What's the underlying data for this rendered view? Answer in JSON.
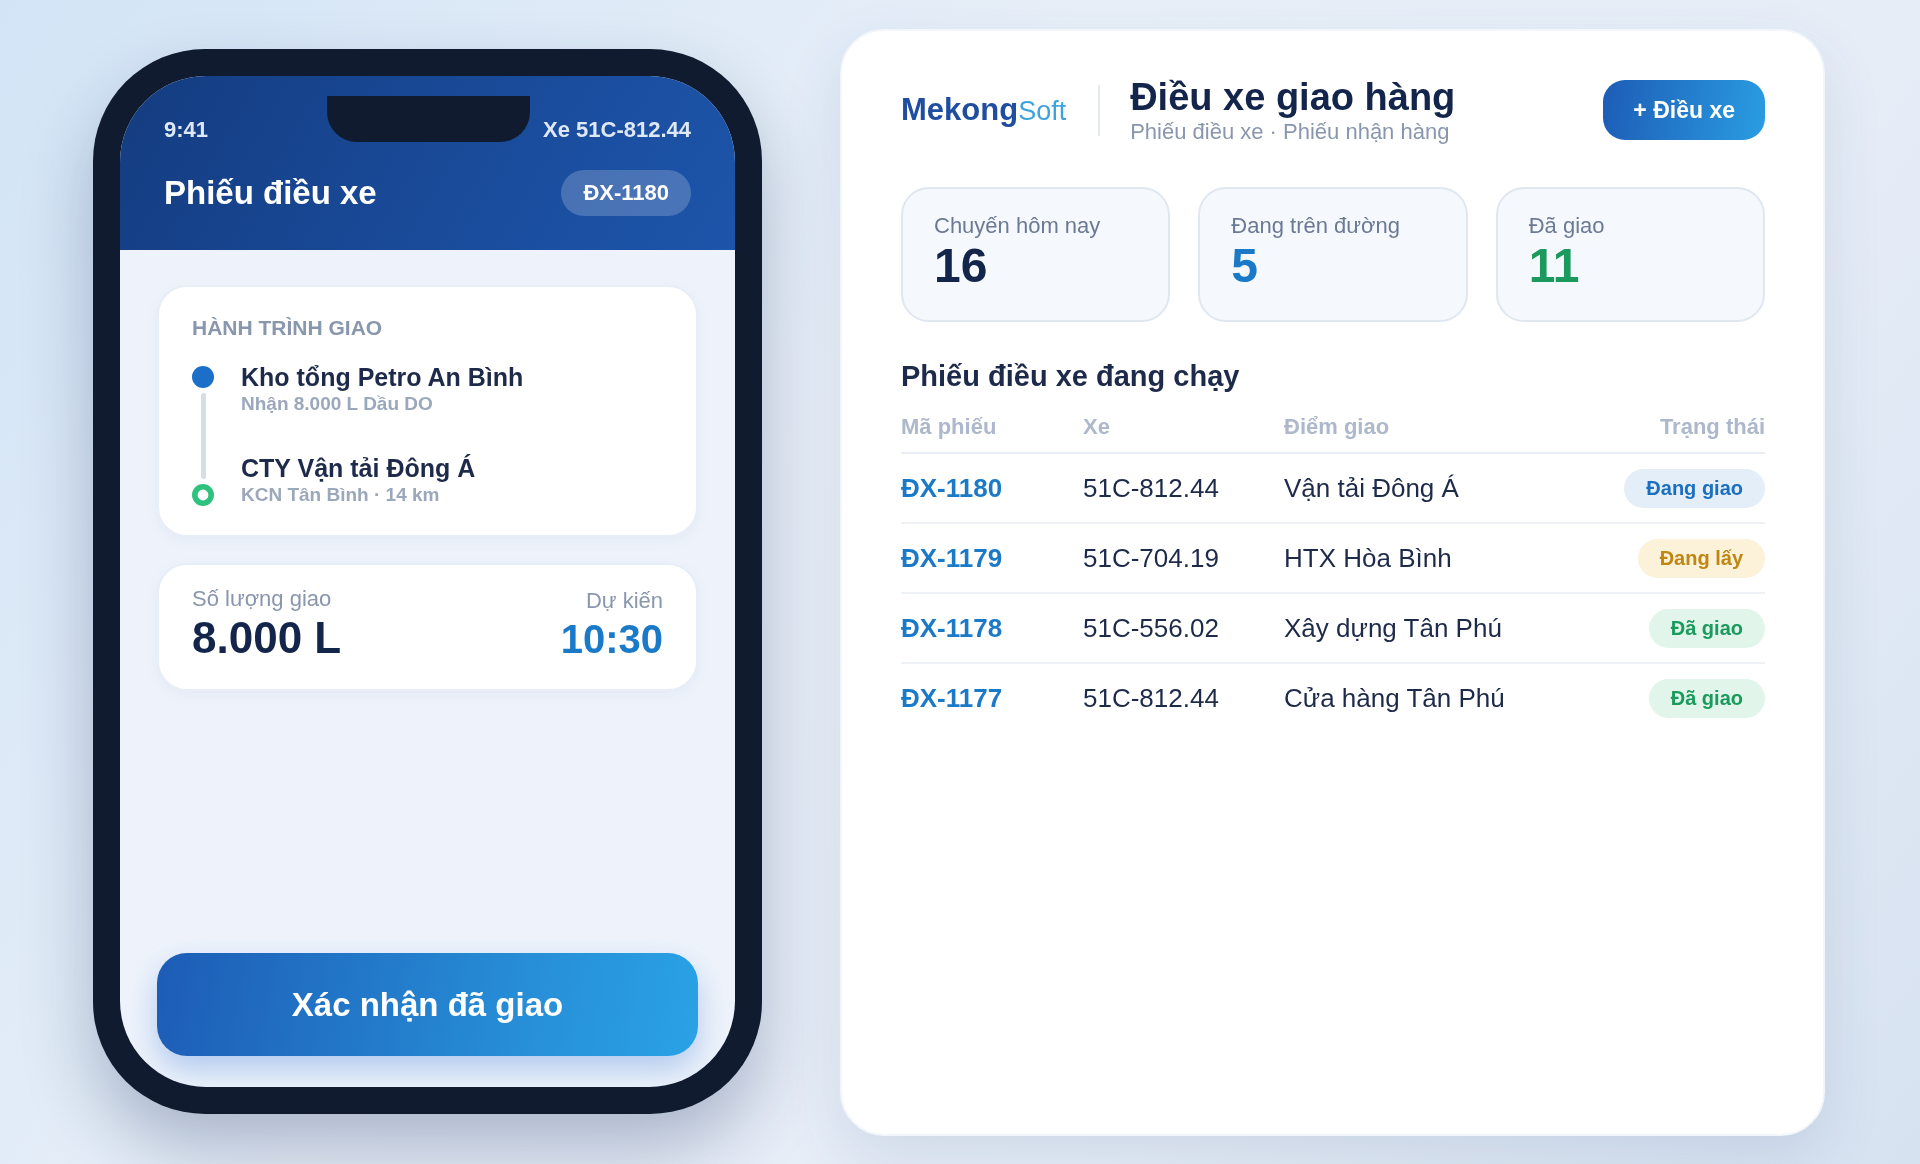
{
  "phone": {
    "status_bar": {
      "time": "9:41",
      "vehicle": "Xe 51C-812.44"
    },
    "header": {
      "title": "Phiếu điều xe",
      "badge": "ĐX-1180"
    },
    "route_card": {
      "heading": "HÀNH TRÌNH GIAO",
      "stops": [
        {
          "kind": "origin",
          "name": "Kho tổng Petro An Bình",
          "detail": "Nhận 8.000 L Dầu DO"
        },
        {
          "kind": "destination",
          "name": "CTY Vận tải Đông Á",
          "detail": "KCN Tân Bình · 14 km"
        }
      ]
    },
    "quantity_card": {
      "quantity_label": "Số lượng giao",
      "quantity": "8.000 L",
      "eta_label": "Dự kiến",
      "eta": "10:30"
    },
    "confirm_button": "Xác nhận đã giao"
  },
  "dashboard": {
    "logo": {
      "primary": "Mekong",
      "secondary": "Soft"
    },
    "title": "Điều xe giao hàng",
    "subtitle": "Phiếu điều xe · Phiếu nhận hàng",
    "action_button": "+ Điều xe",
    "stats": [
      {
        "label": "Chuyến hôm nay",
        "value": "16",
        "color": "#13254a"
      },
      {
        "label": "Đang trên đường",
        "value": "5",
        "color": "#1b7ac8"
      },
      {
        "label": "Đã giao",
        "value": "11",
        "color": "#1a9a5c"
      }
    ],
    "table": {
      "title": "Phiếu điều xe đang chạy",
      "columns": [
        "Mã phiếu",
        "Xe",
        "Điểm giao",
        "Trạng thái"
      ],
      "rows": [
        {
          "code": "ĐX-1180",
          "vehicle": "51C-812.44",
          "destination": "Vận tải Đông Á",
          "status": {
            "label": "Đang giao",
            "kind": "delivering"
          }
        },
        {
          "code": "ĐX-1179",
          "vehicle": "51C-704.19",
          "destination": "HTX Hòa Bình",
          "status": {
            "label": "Đang lấy",
            "kind": "picking"
          }
        },
        {
          "code": "ĐX-1178",
          "vehicle": "51C-556.02",
          "destination": "Xây dựng Tân Phú",
          "status": {
            "label": "Đã giao",
            "kind": "delivered"
          }
        },
        {
          "code": "ĐX-1177",
          "vehicle": "51C-812.44",
          "destination": "Cửa hàng Tân Phú",
          "status": {
            "label": "Đã giao",
            "kind": "delivered"
          }
        }
      ]
    }
  }
}
